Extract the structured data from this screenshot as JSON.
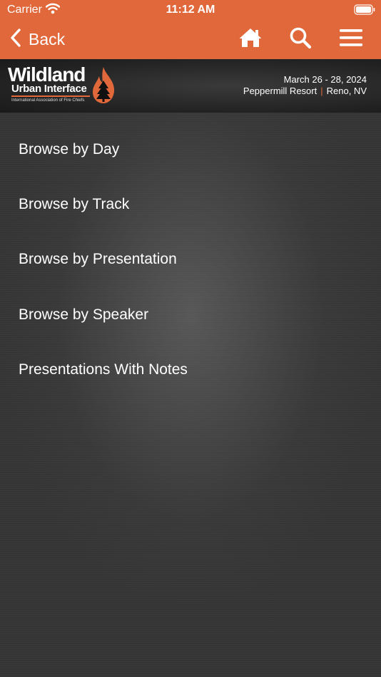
{
  "status": {
    "carrier": "Carrier",
    "time": "11:12 AM"
  },
  "nav": {
    "back_label": "Back",
    "icons": [
      "home-icon",
      "search-icon",
      "menu-icon"
    ]
  },
  "banner": {
    "logo_title": "Wildland",
    "logo_subtitle": "Urban Interface",
    "logo_tagline": "International Association of Fire Chiefs",
    "event_date": "March 26 - 28, 2024",
    "event_venue": "Peppermill Resort",
    "event_city": "Reno, NV"
  },
  "menu": {
    "items": [
      {
        "label": "Browse by Day"
      },
      {
        "label": "Browse by Track"
      },
      {
        "label": "Browse by Presentation"
      },
      {
        "label": "Browse by Speaker"
      },
      {
        "label": "Presentations With Notes"
      }
    ]
  },
  "colors": {
    "accent": "#e1683b",
    "background": "#353535",
    "text": "#ffffff"
  }
}
